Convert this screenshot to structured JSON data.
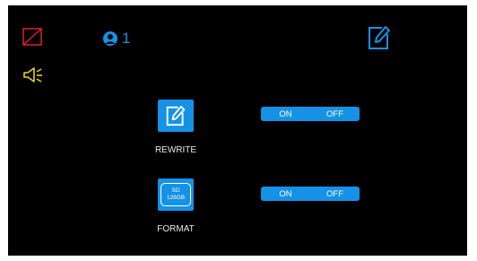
{
  "colors": {
    "accent": "#1592e6",
    "warning_red": "#e0202a",
    "speaker_yellow": "#e8d21c",
    "background": "#000000"
  },
  "status_bar": {
    "slash_icon": "red-slash-box-icon",
    "user_icon": "user-icon",
    "user_count": "1",
    "edit_icon": "edit-icon"
  },
  "speaker": {
    "icon": "speaker-icon"
  },
  "settings": [
    {
      "id": "rewrite",
      "icon": "edit-icon",
      "label": "REWRITE",
      "on_label": "ON",
      "off_label": "OFF"
    },
    {
      "id": "format",
      "icon": "sd-card-icon",
      "card_size": "SD",
      "card_capacity": "128GB",
      "label": "FORMAT",
      "on_label": "ON",
      "off_label": "OFF"
    }
  ]
}
